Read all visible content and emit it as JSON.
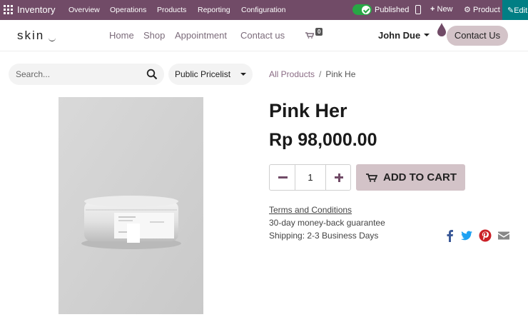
{
  "admin": {
    "app_name": "Inventory",
    "menu": [
      "Overview",
      "Operations",
      "Products",
      "Reporting",
      "Configuration"
    ],
    "published_label": "Published",
    "new_label": "New",
    "product_label": "Product",
    "edit_label": "Edit",
    "bar_color": "#714b67",
    "toggle_color": "#28a745",
    "edit_color": "#017e84"
  },
  "site": {
    "logo_text": "skin",
    "nav": [
      "Home",
      "Shop",
      "Appointment",
      "Contact us"
    ],
    "cart_count": "0",
    "user_name": "John Due",
    "contact_label": "Contact Us",
    "accent": "#d3c3c8"
  },
  "search": {
    "placeholder": "Search..."
  },
  "pricelist": {
    "label": "Public Pricelist"
  },
  "breadcrumb": {
    "root": "All Products",
    "separator": "/",
    "current": "Pink He"
  },
  "product": {
    "name": "Pink Her",
    "price": "Rp 98,000.00",
    "quantity": "1",
    "add_to_cart": "ADD TO CART",
    "terms": "Terms and Conditions",
    "guarantee": "30-day money-back guarantee",
    "shipping": "Shipping: 2-3 Business Days"
  },
  "share_icons": [
    "facebook-icon",
    "twitter-icon",
    "pinterest-icon",
    "envelope-icon"
  ]
}
